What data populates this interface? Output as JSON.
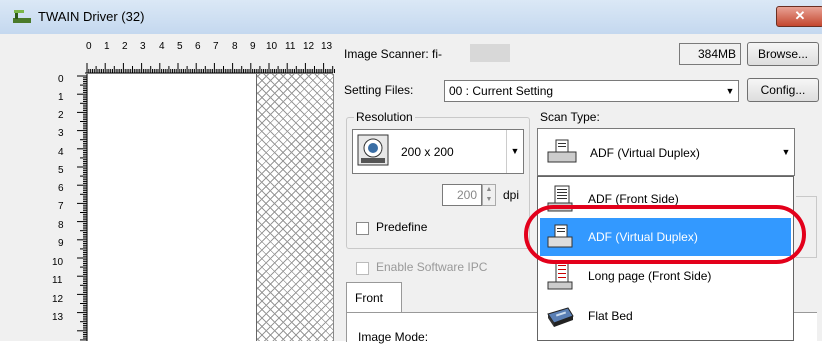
{
  "window": {
    "title": "TWAIN Driver (32)",
    "close_label": "✕"
  },
  "ruler": {
    "top_numbers": [
      "0",
      "1",
      "2",
      "3",
      "4",
      "5",
      "6",
      "7",
      "8",
      "9",
      "10",
      "11",
      "12",
      "13"
    ],
    "left_numbers": [
      "0",
      "1",
      "2",
      "3",
      "4",
      "5",
      "6",
      "7",
      "8",
      "9",
      "10",
      "11",
      "12",
      "13"
    ]
  },
  "scanner": {
    "label": "Image Scanner: fi-",
    "memory": "384MB",
    "browse_label": "Browse..."
  },
  "setting_files": {
    "label": "Setting Files:",
    "value": "00 : Current Setting",
    "config_label": "Config..."
  },
  "resolution": {
    "group_label": "Resolution",
    "value": "200 x 200",
    "custom_value": "200",
    "unit": "dpi",
    "predefine_label": "Predefine"
  },
  "scan_type": {
    "label": "Scan Type:",
    "selected": "ADF (Virtual Duplex)",
    "options": [
      {
        "label": "ADF (Front Side)",
        "icon": "adf-front-icon"
      },
      {
        "label": "ADF (Virtual Duplex)",
        "icon": "adf-duplex-icon"
      },
      {
        "label": "Long page (Front Side)",
        "icon": "long-page-icon"
      },
      {
        "label": "Flat Bed",
        "icon": "flatbed-icon"
      }
    ]
  },
  "software_ipc": {
    "label": "Enable Software IPC"
  },
  "tabs": {
    "front": "Front"
  },
  "image_mode": {
    "label": "Image Mode:"
  },
  "colors": {
    "highlight": "#e3001b",
    "selection": "#3399ff"
  }
}
